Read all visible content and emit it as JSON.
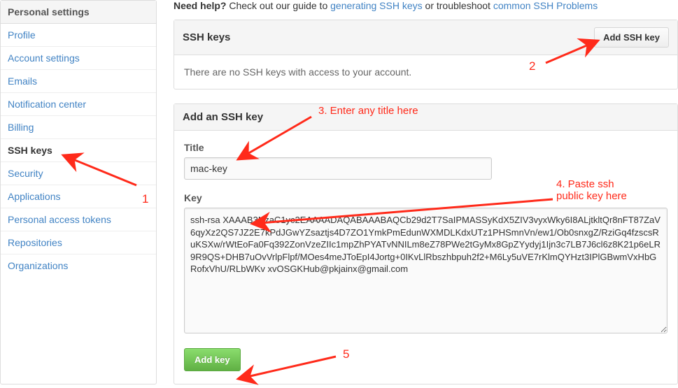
{
  "sidebar": {
    "header": "Personal settings",
    "items": [
      {
        "label": "Profile"
      },
      {
        "label": "Account settings"
      },
      {
        "label": "Emails"
      },
      {
        "label": "Notification center"
      },
      {
        "label": "Billing"
      },
      {
        "label": "SSH keys",
        "active": true
      },
      {
        "label": "Security"
      },
      {
        "label": "Applications"
      },
      {
        "label": "Personal access tokens"
      },
      {
        "label": "Repositories"
      },
      {
        "label": "Organizations"
      }
    ]
  },
  "help": {
    "prefix": "Need help?",
    "mid1": " Check out our guide to ",
    "link1": "generating SSH keys",
    "mid2": " or troubleshoot ",
    "link2": "common SSH Problems"
  },
  "keys_panel": {
    "title": "SSH keys",
    "add_button": "Add SSH key",
    "empty_msg": "There are no SSH keys with access to your account."
  },
  "form": {
    "heading": "Add an SSH key",
    "title_label": "Title",
    "title_value": "mac-key",
    "key_label": "Key",
    "key_value": "ssh-rsa XAAAB3NzaC1yc2EAAAADAQABAAABAQCb29d2T7SaIPMASSyKdX5ZIV3vyxWky6I8ALjtkltQr8nFT87ZaV6qyXz2QS7JZ2E7kPdJGwYZsaztjs4D7ZO1YmkPmEdunWXMDLKdxUTz1PHSmnVn/ew1/Ob0snxgZ/RziGq4fzscsRuKSXw/rWtEoFa0Fq392ZonVzeZIIc1mpZhPYATvNNILm8eZ78PWe2tGyMx8GpZYydyj1Ijn3c7LB7J6cl6z8K21p6eLR9R9QS+DHB7uOvVrlpFlpf/MOes4meJToEpI4Jortg+0IKvLlRbszhbpuh2f2+M6Ly5uVE7rKlmQYHzt3IPlGBwmVxHbGRofxVhU/RLbWKv xvOSGKHub@pkjainx@gmail.com",
    "submit": "Add key"
  },
  "annotations": {
    "n1": "1",
    "n2": "2",
    "n3": "3. Enter any title here",
    "n4a": "4. Paste ssh",
    "n4b": "public key here",
    "n5": "5"
  }
}
